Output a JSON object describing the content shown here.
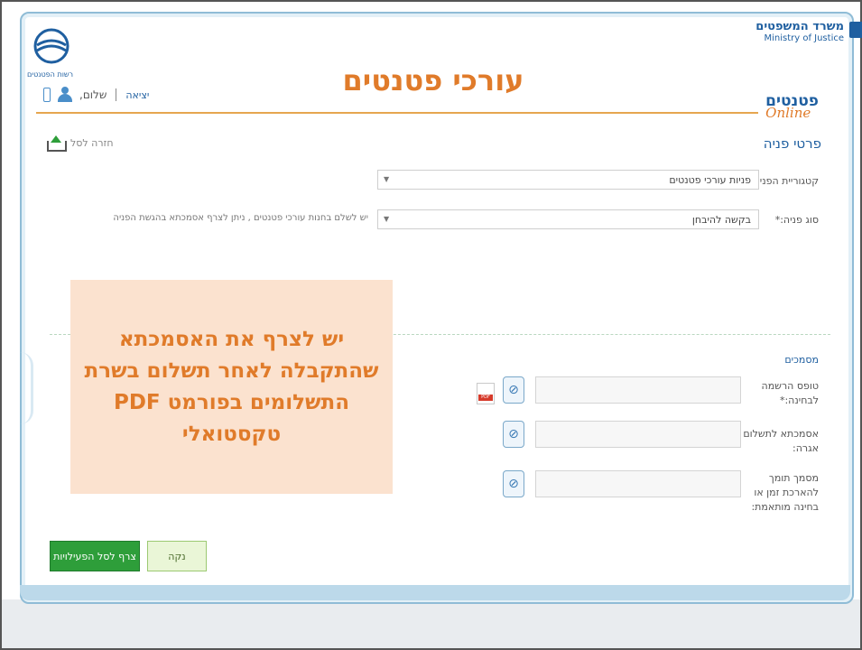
{
  "header": {
    "logo_caption": "רשות הפטנטים",
    "ministry_hebrew": "משרד המשפטים",
    "ministry_english": "Ministry of Justice",
    "page_title": "עורכי פטנטים",
    "patents_hebrew": "פטנטים",
    "patents_online": "Online",
    "greeting": "שלום,",
    "logout": "יציאה"
  },
  "nav": {
    "back_label": "חזרה לסל"
  },
  "form": {
    "section_title": "פרטי פניה",
    "category_label": "קטגוריית הפניה:",
    "category_value": "פניות עורכי פטנטים",
    "type_label": "סוג פניה:*",
    "type_value": "בקשה להיבחן",
    "type_note": "יש לשלם בחנות עורכי פטנטים , ניתן לצרף אסמכתא בהגשת הפניה"
  },
  "documents": {
    "title": "מסמכים",
    "items": [
      {
        "label": "טופס הרשמה לבחינה:*"
      },
      {
        "label": "אסמכתא לתשלום אגרה:"
      },
      {
        "label": "מסמך תומך להארכת זמן או בחינה מותאמת:"
      }
    ]
  },
  "callout": {
    "text": "יש לצרף את האסמכתא שהתקבלה לאחר תשלום בשרת התשלומים בפורמט PDF טקסטואלי"
  },
  "actions": {
    "attach_label": "צרף לסל הפעילויות",
    "clear_label": "נקה"
  },
  "colors": {
    "accent_orange": "#e07b2a",
    "brand_blue": "#1f5fa0",
    "action_green": "#2e9e3a"
  }
}
